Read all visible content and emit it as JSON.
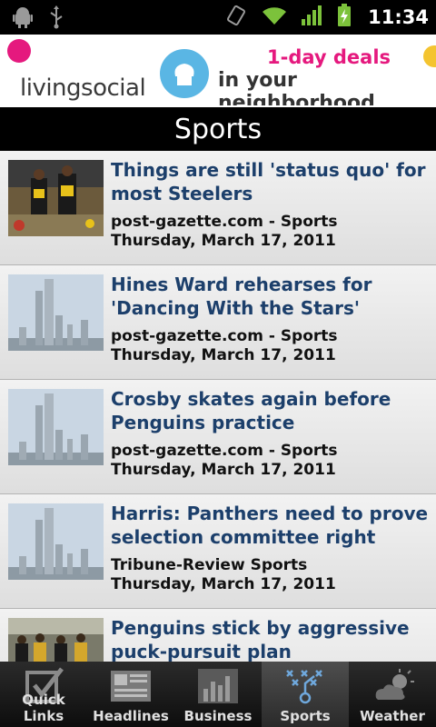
{
  "status_bar": {
    "time": "11:34"
  },
  "ad": {
    "brand": "livingsocial",
    "line1": "1-day deals",
    "line2": "in your neighborhood"
  },
  "section": {
    "title": "Sports"
  },
  "articles": [
    {
      "headline": "Things are still 'status quo' for most Steelers",
      "source": "post-gazette.com - Sports",
      "date": "Thursday, March 17, 2011",
      "thumb": "players"
    },
    {
      "headline": "Hines Ward rehearses for 'Dancing With the Stars'",
      "source": "post-gazette.com - Sports",
      "date": "Thursday, March 17, 2011",
      "thumb": "skyline"
    },
    {
      "headline": "Crosby skates again before Penguins practice",
      "source": "post-gazette.com - Sports",
      "date": "Thursday, March 17, 2011",
      "thumb": "skyline"
    },
    {
      "headline": "Harris: Panthers need to prove selection committee right",
      "source": "Tribune-Review Sports",
      "date": "Thursday, March 17, 2011",
      "thumb": "skyline"
    },
    {
      "headline": "Penguins stick by aggressive puck-pursuit plan",
      "source": "",
      "date": "",
      "thumb": "crowd"
    }
  ],
  "tabs": [
    {
      "label": "Quick Links",
      "icon": "checkbox-icon"
    },
    {
      "label": "Headlines",
      "icon": "newspaper-icon"
    },
    {
      "label": "Business",
      "icon": "bar-chart-icon"
    },
    {
      "label": "Sports",
      "icon": "playbook-icon",
      "active": true
    },
    {
      "label": "Weather",
      "icon": "weather-icon"
    }
  ]
}
